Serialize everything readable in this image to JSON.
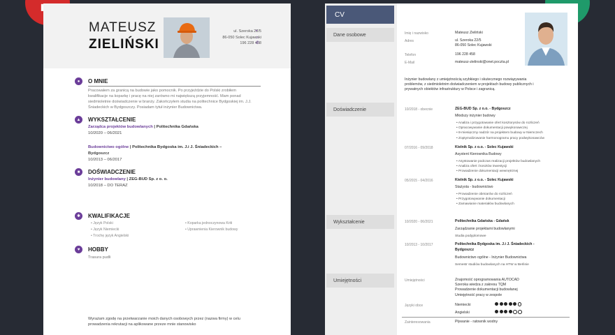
{
  "left_cv": {
    "first_name": "MATEUSZ",
    "last_name": "ZIELIŃSKI",
    "contact": [
      "ul. Szeroka 22/5",
      "86-050 Solec Kujawski",
      "196 228 458"
    ],
    "about": {
      "title": "O MNIE",
      "text": [
        "Pracowałem za granicą na budowie jako pomocnik. Po przyjeździe do Polski zrobiłem",
        "kwalifikacje na koparkę i pracę na niej zarówno mi największą przyjemność. Mam ponad",
        "siedmioletnie doświadczenie w branży. Zakończyłem studia na politechnice Bydgoskiej im. J.J.",
        "Śniadeckich w Bydgoszczy. Posiadam tytuł inżynier Budownictwa."
      ]
    },
    "education": {
      "title": "WYKSZTAŁCENIE",
      "items": [
        {
          "field": "Zarządca projektów budowlanych",
          "school": "| Politechnika Gdańska",
          "school_cont": "",
          "dates": "10/2020 – 06/2021"
        },
        {
          "field": "Budownictwo ogólne",
          "school": "| Politechnika Bydgoska im. J.i J. Śniadeckich –",
          "school_cont": "Bydgoszcz",
          "dates": "10/2013 – 06/2017"
        }
      ]
    },
    "experience": {
      "title": "DOŚWIADCZENIE",
      "items": [
        {
          "role": "Inżynier budowlany",
          "company": "| ZEG-BUD Sp. z o. o.",
          "dates": "10/2018 – DO TERAZ"
        }
      ]
    },
    "skills": {
      "title": "KWALIFIKACJE",
      "col1": [
        "Język Polski",
        "Język Niemiecki",
        "Trochę język Angielski"
      ],
      "col2": [
        "Koparka jednoczynowa Kriti",
        "Uprawnienia Kierownik budowy"
      ]
    },
    "hobby": {
      "title": "HOBBY",
      "text": "Trasura pudli"
    },
    "consent": [
      "Wyrażam zgodę na przetwarzanie moich danych osobowych przez (nazwa firmy) w celu",
      "prowadzenia rekrutacji na aplikowane przeze mnie stanowisko"
    ]
  },
  "right_cv": {
    "cv_label": "CV",
    "section_labels": {
      "personal": "Dane osobowe",
      "experience": "Doświadczenie",
      "education": "Wykształcenie",
      "skills": "Umiejętności"
    },
    "personal": {
      "name_label": "Imię i nazwisko",
      "name": "Mateusz Zieliński",
      "address_label": "Adres",
      "address": [
        "ul. Szeroka 22/5",
        "86-050 Solec Kujawski"
      ],
      "phone_label": "Telefon",
      "phone": "196 228 458",
      "email_label": "E-Mail",
      "email": "mateusz-zielinski@onet.poczta.pl"
    },
    "summary": [
      "Inżynier budowlany z umiejętnością szybkiego i skutecznego rozwiązywania",
      "problemów, z siedmioletnim doświadczeniem w projektach budowy publicznych i",
      "prywatnych obiektów infrastruktury w Polsce i zagranicą."
    ],
    "experience": [
      {
        "dates": "10/2018 - obecnie",
        "company": "ZEG-BUD Sp. z o.o. - Bydgoszcz",
        "role": "Młodszy inżynier budowy",
        "bullets": [
          "Analiza i przygotowanie ofert kosztorysów do rozliczeń",
          "Opracowywanie dokumentacji powykonawczej",
          "8-miesięczny nadzór na projektem budowy w Niemczech",
          "Zoptymalizowanie harmonogramu pracy podwykonawców"
        ]
      },
      {
        "dates": "07/2016 - 09/2018",
        "company": "Kielnik Sp. z o.o. - Solec Kujawski",
        "role": "Asystent Kierownika Budowy",
        "bullets": [
          "Asystowanie podczas realizacji projektów budowlanych",
          "Analiza ofert i kosztów inwestycji",
          "Prowadzenie dokumentacji wewnętrznej"
        ]
      },
      {
        "dates": "05/2015 - 04/2016",
        "company": "Kielnik Sp. z o.o. - Solec Kujawski",
        "role": "Stażysta - budownictwo",
        "bullets": [
          "Prowadzenie obmiarów do rozliczeń",
          "Przygotowywanie dokumentacji",
          "Zamawianie materiałów budowlanych"
        ]
      }
    ],
    "education": [
      {
        "dates": "10/2020 - 06/2021",
        "school": "Politechnika Gdańska - Gdańsk",
        "school_cont": "",
        "field": "Zarządzanie projektami budowlanymi",
        "note": "Studia podyplomowe"
      },
      {
        "dates": "10/2013 - 10/2017",
        "school": "Politechnika Bydgoska im. J.i J. Śniadeckich -",
        "school_cont": "Bydgoszcz",
        "field": "Budownictwo ogólne - Inżynier Budownictwa",
        "note": "Semestr studiów budowlanych na HTW w Berlinie"
      }
    ],
    "skills": {
      "label": "Umiejętności",
      "items": [
        "Znajomość oprogramowania AUTOCAD",
        "Szeroka wiedza z zakresu TQM",
        "Prowadzenie dokumentacji budowlanej",
        "Umiejętność pracy w zespole"
      ],
      "lang_label": "Języki obce",
      "languages": [
        {
          "name": "Niemiecki",
          "level": 5,
          "max": 6
        },
        {
          "name": "Angielski",
          "level": 4,
          "max": 6
        }
      ],
      "hobby_label": "Zainteresowania",
      "hobby": "Pływanie - ratownik wodny"
    }
  }
}
